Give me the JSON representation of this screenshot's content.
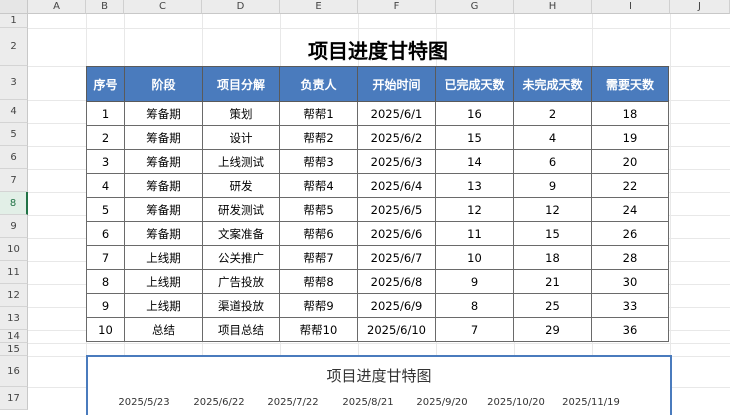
{
  "columns": [
    "A",
    "B",
    "C",
    "D",
    "E",
    "F",
    "G",
    "H",
    "I",
    "J"
  ],
  "rows": [
    "1",
    "2",
    "3",
    "4",
    "5",
    "6",
    "7",
    "8",
    "9",
    "10",
    "11",
    "12",
    "13",
    "14",
    "15",
    "16",
    "17"
  ],
  "sheet": {
    "title": "项目进度甘特图",
    "headers": [
      "序号",
      "阶段",
      "项目分解",
      "负责人",
      "开始时间",
      "已完成天数",
      "未完成天数",
      "需要天数"
    ],
    "table": [
      [
        "1",
        "筹备期",
        "策划",
        "帮帮1",
        "2025/6/1",
        "16",
        "2",
        "18"
      ],
      [
        "2",
        "筹备期",
        "设计",
        "帮帮2",
        "2025/6/2",
        "15",
        "4",
        "19"
      ],
      [
        "3",
        "筹备期",
        "上线测试",
        "帮帮3",
        "2025/6/3",
        "14",
        "6",
        "20"
      ],
      [
        "4",
        "筹备期",
        "研发",
        "帮帮4",
        "2025/6/4",
        "13",
        "9",
        "22"
      ],
      [
        "5",
        "筹备期",
        "研发测试",
        "帮帮5",
        "2025/6/5",
        "12",
        "12",
        "24"
      ],
      [
        "6",
        "筹备期",
        "文案准备",
        "帮帮6",
        "2025/6/6",
        "11",
        "15",
        "26"
      ],
      [
        "7",
        "上线期",
        "公关推广",
        "帮帮7",
        "2025/6/7",
        "10",
        "18",
        "28"
      ],
      [
        "8",
        "上线期",
        "广告投放",
        "帮帮8",
        "2025/6/8",
        "9",
        "21",
        "30"
      ],
      [
        "9",
        "上线期",
        "渠道投放",
        "帮帮9",
        "2025/6/9",
        "8",
        "25",
        "33"
      ],
      [
        "10",
        "总结",
        "项目总结",
        "帮帮10",
        "2025/6/10",
        "7",
        "29",
        "36"
      ]
    ]
  },
  "chart": {
    "title": "项目进度甘特图",
    "axis_labels": [
      "2025/5/23",
      "2025/6/22",
      "2025/7/22",
      "2025/8/21",
      "2025/9/20",
      "2025/10/20",
      "2025/11/19"
    ]
  },
  "colors": {
    "header_fill": "#4a7bbd",
    "header_text": "#ffffff",
    "chart_border": "#4a7bbd"
  }
}
